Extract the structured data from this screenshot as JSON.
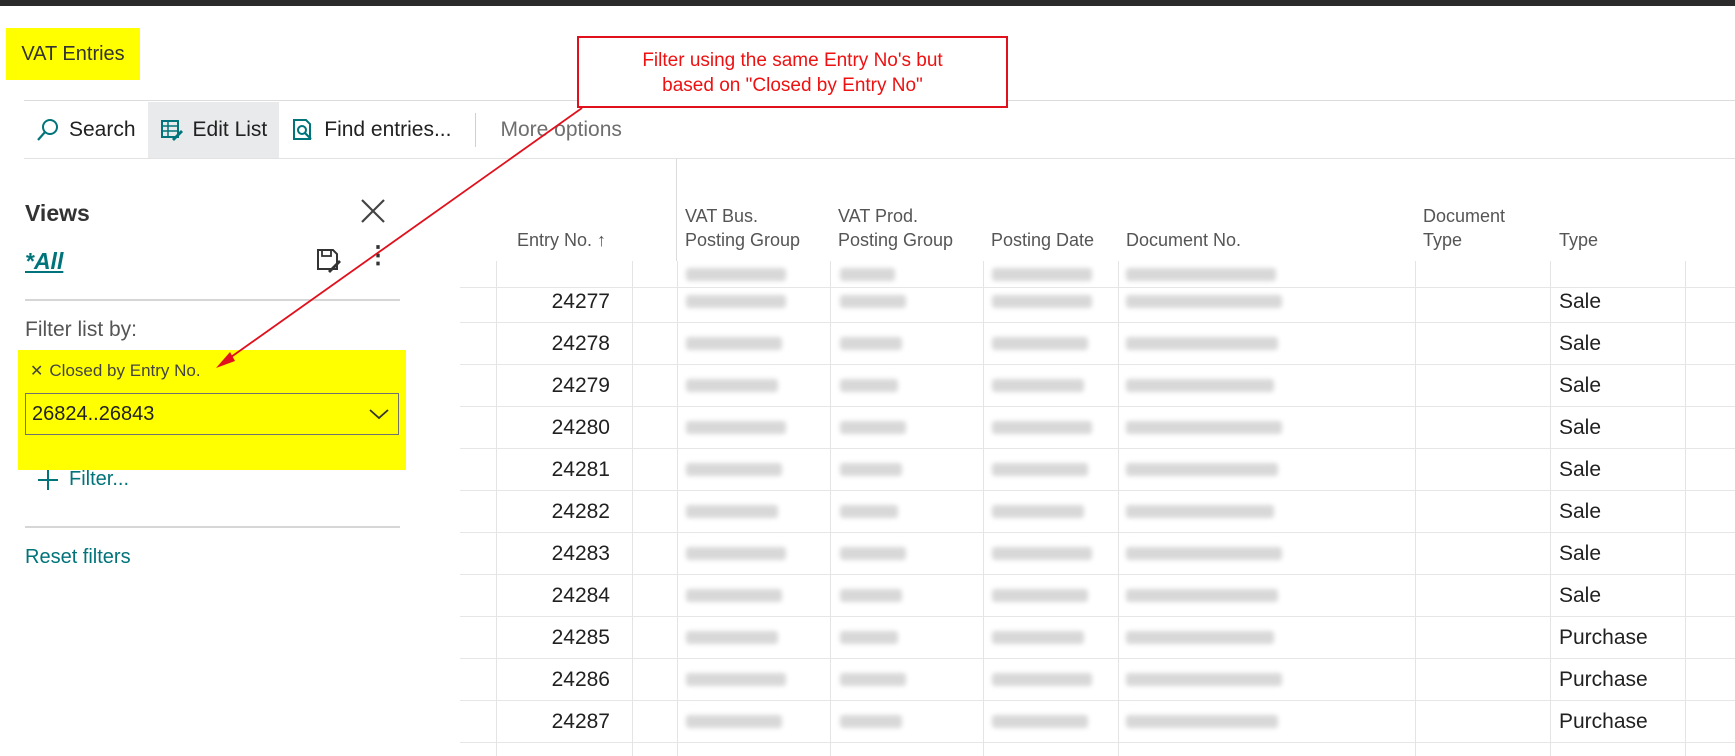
{
  "page": {
    "title": "VAT Entries"
  },
  "actions": {
    "search": "Search",
    "edit_list": "Edit List",
    "find_entries": "Find entries...",
    "more_options": "More options"
  },
  "views": {
    "title": "Views",
    "current": "*All",
    "filter_list_by": "Filter list by:",
    "filter_field": "Closed by Entry No.",
    "filter_value": "26824..26843",
    "add_filter": "Filter...",
    "reset_filters": "Reset filters"
  },
  "annotation": {
    "line1": "Filter using the same Entry No's but",
    "line2": "based on \"Closed by Entry No\"",
    "color": "#e0101c"
  },
  "columns": {
    "entry_no": "Entry No. ↑",
    "vat_bus_1": "VAT Bus.",
    "vat_bus_2": "Posting Group",
    "vat_prod_1": "VAT Prod.",
    "vat_prod_2": "Posting Group",
    "posting_date": "Posting Date",
    "document_no": "Document No.",
    "document_type_1": "Document",
    "document_type_2": "Type",
    "type": "Type"
  },
  "rows": [
    {
      "entry_no": "24277",
      "type": "Sale"
    },
    {
      "entry_no": "24278",
      "type": "Sale"
    },
    {
      "entry_no": "24279",
      "type": "Sale"
    },
    {
      "entry_no": "24280",
      "type": "Sale"
    },
    {
      "entry_no": "24281",
      "type": "Sale"
    },
    {
      "entry_no": "24282",
      "type": "Sale"
    },
    {
      "entry_no": "24283",
      "type": "Sale"
    },
    {
      "entry_no": "24284",
      "type": "Sale"
    },
    {
      "entry_no": "24285",
      "type": "Purchase"
    },
    {
      "entry_no": "24286",
      "type": "Purchase"
    },
    {
      "entry_no": "24287",
      "type": "Purchase"
    }
  ],
  "colors": {
    "accent": "#00747a",
    "highlight": "#ffff00"
  },
  "icons": [
    "search-icon",
    "edit-list-icon",
    "find-entries-icon",
    "close-icon",
    "save-view-icon",
    "more-vertical-icon",
    "chevron-down-icon",
    "plus-icon",
    "remove-filter-icon",
    "sort-ascending-icon"
  ]
}
